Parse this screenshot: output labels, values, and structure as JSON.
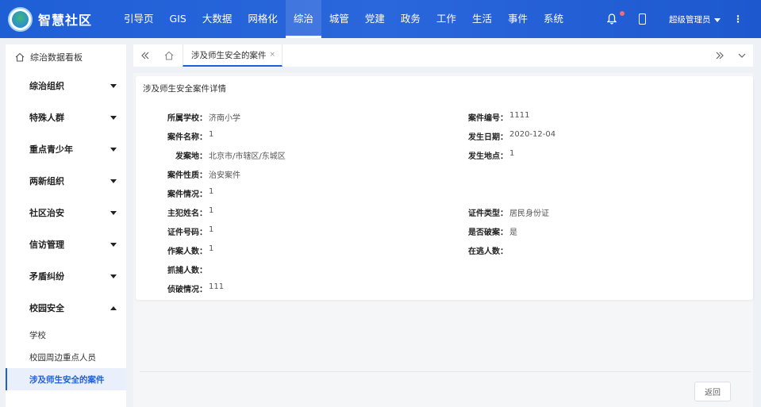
{
  "header": {
    "brand": "智慧社区",
    "nav": [
      "引导页",
      "GIS",
      "大数据",
      "网格化",
      "综治",
      "城管",
      "党建",
      "政务",
      "工作",
      "生活",
      "事件",
      "系统"
    ],
    "active_nav": "综治",
    "user": "超级管理员",
    "more": "⋮"
  },
  "sidebar": {
    "top_item": "综治数据看板",
    "groups": [
      "综治组织",
      "特殊人群",
      "重点青少年",
      "两新组织",
      "社区治安",
      "信访管理",
      "矛盾纠纷",
      "校园安全"
    ],
    "expanded_group": "校园安全",
    "sub_items": [
      "学校",
      "校园周边重点人员",
      "涉及师生安全的案件"
    ],
    "active_sub": "涉及师生安全的案件"
  },
  "tabs": {
    "active_tab": "涉及师生安全的案件",
    "close": "×"
  },
  "detail": {
    "title": "涉及师生安全案件详情",
    "fields": [
      {
        "label": "所属学校：",
        "value": "济南小学"
      },
      {
        "label": "案件编号：",
        "value": "1111"
      },
      {
        "label": "案件名称：",
        "value": "1"
      },
      {
        "label": "发生日期：",
        "value": "2020-12-04"
      },
      {
        "label": "发案地：",
        "value": "北京市/市辖区/东城区"
      },
      {
        "label": "发生地点：",
        "value": "1"
      },
      {
        "label": "案件性质：",
        "value": "治安案件"
      },
      {
        "label": "案件情况：",
        "value": "1"
      },
      {
        "label": "主犯姓名：",
        "value": "1"
      },
      {
        "label": "证件类型：",
        "value": "居民身份证"
      },
      {
        "label": "证件号码：",
        "value": "1"
      },
      {
        "label": "是否破案：",
        "value": "是"
      },
      {
        "label": "作案人数：",
        "value": "1"
      },
      {
        "label": "在逃人数：",
        "value": ""
      },
      {
        "label": "抓捕人数：",
        "value": ""
      },
      {
        "label": "侦破情况：",
        "value": "111"
      }
    ]
  },
  "footer": {
    "back_label": "返回"
  },
  "colors": {
    "primary": "#1f5fd6",
    "header": "#2a66dc",
    "badge": "#f56c6c"
  }
}
